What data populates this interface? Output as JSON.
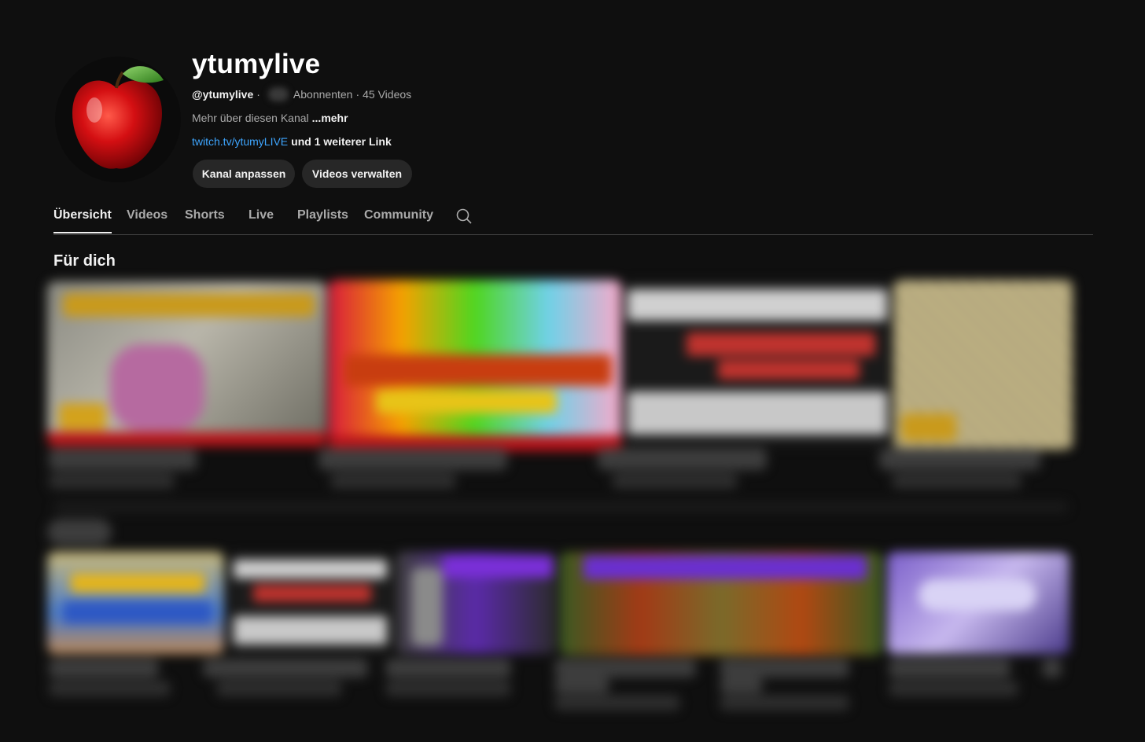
{
  "channel": {
    "name": "ytumylive",
    "handle": "@ytumylive",
    "separator1": "·",
    "subscribers_label": "Abonnenten",
    "separator2": "·",
    "videos_count": "45 Videos",
    "about_text": "Mehr über diesen Kanal",
    "about_more": "...mehr",
    "link_text": "twitch.tv/ytumyLIVE",
    "extra_links": "und 1 weiterer Link"
  },
  "buttons": {
    "customize": "Kanal anpassen",
    "manage": "Videos verwalten"
  },
  "tabs": [
    {
      "label": "Übersicht"
    },
    {
      "label": "Videos"
    },
    {
      "label": "Shorts"
    },
    {
      "label": "Live"
    },
    {
      "label": "Playlists"
    },
    {
      "label": "Community"
    }
  ],
  "sections": {
    "for_you": "Für dich"
  },
  "icons": {
    "avatar": "red-apple-image",
    "search": "search-icon"
  },
  "colors": {
    "background": "#0f0f0f",
    "link": "#3ea6ff",
    "button_bg": "#272727"
  }
}
